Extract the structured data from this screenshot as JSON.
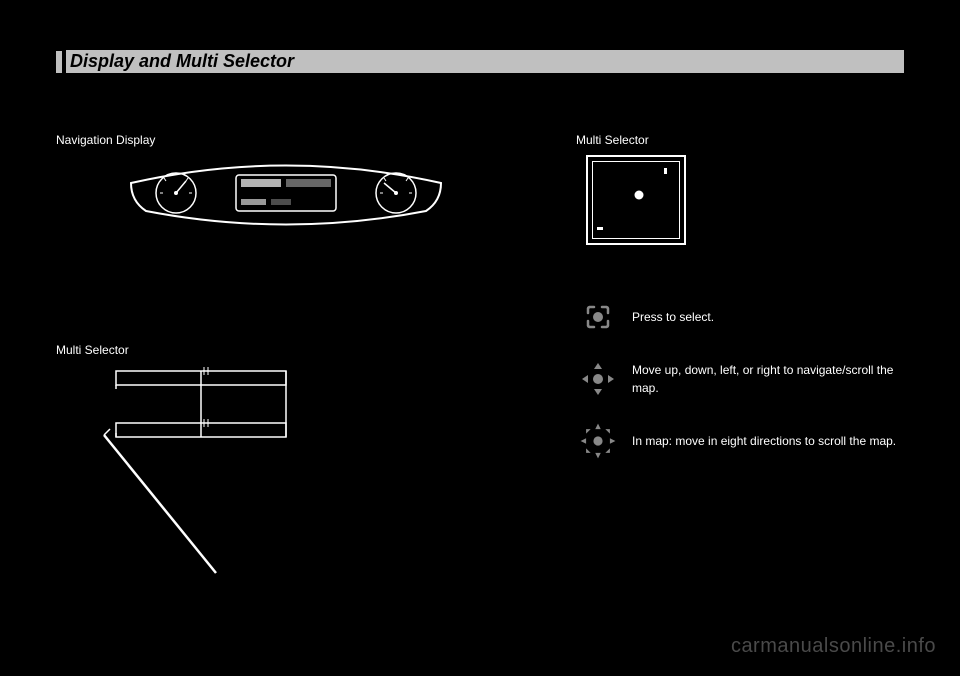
{
  "heading": "Display and Multi Selector",
  "dashboard_label": "Navigation Display",
  "console_label": "Multi Selector",
  "right_label": "Multi Selector",
  "instructions": [
    {
      "text": "Press to select."
    },
    {
      "text": "Move up, down, left, or right to navigate/scroll the map."
    },
    {
      "text": "In map: move in eight directions to scroll the map."
    }
  ],
  "watermark": "carmanualsonline.info",
  "page_number": ""
}
